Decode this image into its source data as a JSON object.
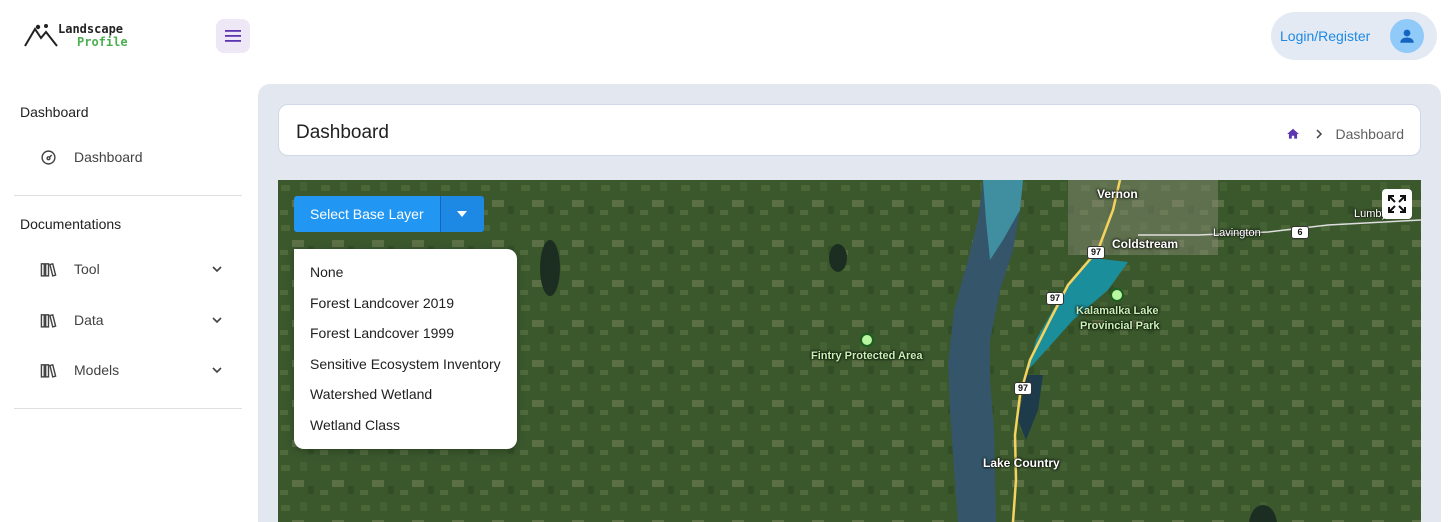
{
  "header": {
    "logo_line1": "Landscape",
    "logo_line2": "Profile",
    "login_label": "Login/Register"
  },
  "sidebar": {
    "section1_title": "Dashboard",
    "dashboard_label": "Dashboard",
    "section2_title": "Documentations",
    "items": [
      {
        "label": "Tool",
        "icon": "library-books-icon"
      },
      {
        "label": "Data",
        "icon": "library-books-icon"
      },
      {
        "label": "Models",
        "icon": "library-books-icon"
      }
    ]
  },
  "main": {
    "page_title": "Dashboard",
    "breadcrumb_current": "Dashboard"
  },
  "map": {
    "base_layer_button": "Select Base Layer",
    "base_layer_options": [
      "None",
      "Forest Landcover 2019",
      "Forest Landcover 1999",
      "Sensitive Ecosystem Inventory",
      "Watershed Wetland",
      "Wetland Class"
    ],
    "places": {
      "vernon": "Vernon",
      "coldstream": "Coldstream",
      "lavington": "Lavington",
      "lumby": "Lumby",
      "kalamalka_1": "Kalamalka Lake",
      "kalamalka_2": "Provincial Park",
      "fintry": "Fintry Protected Area",
      "lake_country": "Lake Country"
    },
    "highway_labels": {
      "h97": "97",
      "h6": "6"
    }
  },
  "colors": {
    "accent_purple": "#5e35b1",
    "primary_blue": "#2196f3",
    "login_blue": "#1e88e5",
    "logo_green": "#4caf50"
  }
}
